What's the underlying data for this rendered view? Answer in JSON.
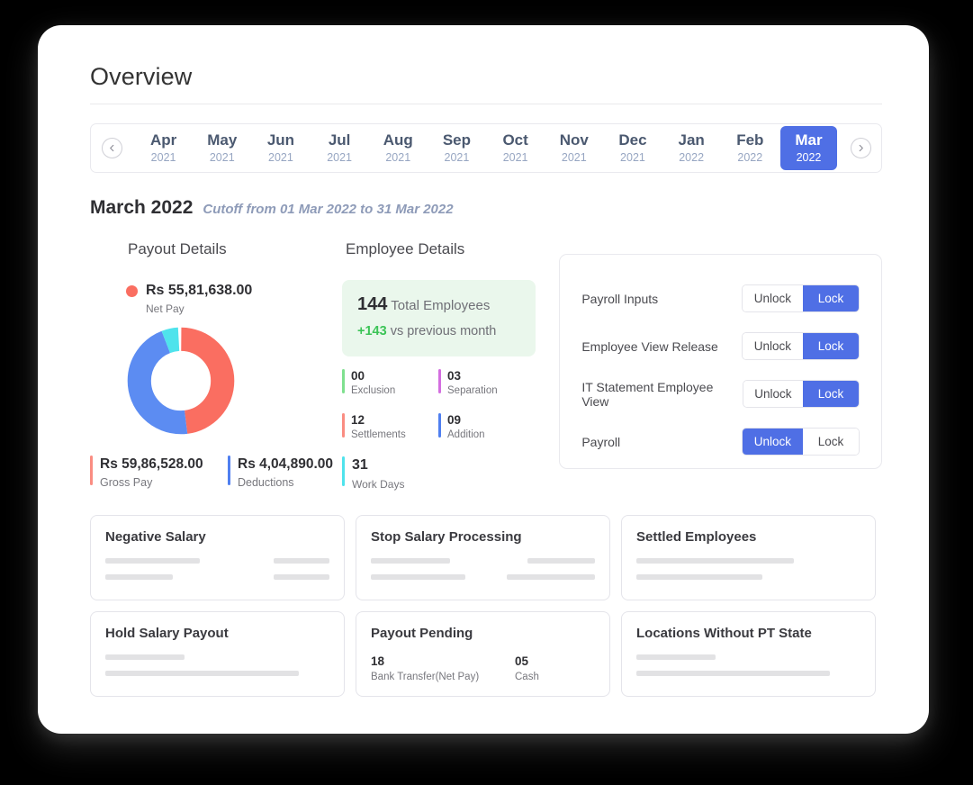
{
  "page": {
    "title": "Overview"
  },
  "month_selector": {
    "prev_icon": "chevron-left-icon",
    "next_icon": "chevron-right-icon",
    "selected_index": 11,
    "months": [
      {
        "month": "Apr",
        "year": "2021"
      },
      {
        "month": "May",
        "year": "2021"
      },
      {
        "month": "Jun",
        "year": "2021"
      },
      {
        "month": "Jul",
        "year": "2021"
      },
      {
        "month": "Aug",
        "year": "2021"
      },
      {
        "month": "Sep",
        "year": "2021"
      },
      {
        "month": "Oct",
        "year": "2021"
      },
      {
        "month": "Nov",
        "year": "2021"
      },
      {
        "month": "Dec",
        "year": "2021"
      },
      {
        "month": "Jan",
        "year": "2022"
      },
      {
        "month": "Feb",
        "year": "2022"
      },
      {
        "month": "Mar",
        "year": "2022"
      }
    ]
  },
  "cutoff": {
    "period": "March 2022",
    "text": "Cutoff from 01 Mar 2022 to 31 Mar 2022"
  },
  "payout_details": {
    "heading": "Payout Details",
    "net_pay": {
      "value": "Rs 55,81,638.00",
      "label": "Net Pay",
      "color": "#fa6e61"
    },
    "gross_pay": {
      "value": "Rs 59,86,528.00",
      "label": "Gross Pay",
      "color": "#fa8d82"
    },
    "deductions": {
      "value": "Rs 4,04,890.00",
      "label": "Deductions",
      "color": "#4f7ff0"
    }
  },
  "chart_data": {
    "type": "pie",
    "title": "Payout Details",
    "categories": [
      "Net Pay",
      "Deductions",
      "Work Days"
    ],
    "values": [
      55.82,
      4.05,
      5.0
    ],
    "percentages": [
      48,
      46,
      6
    ],
    "colors": [
      "#fa6e61",
      "#5c8cf2",
      "#4fe3ec"
    ],
    "donut": true,
    "legend": "top-left"
  },
  "employee_details": {
    "heading": "Employee Details",
    "summary": {
      "count": "144",
      "count_label": "Total Employees",
      "delta": "+143",
      "delta_label": "vs previous month",
      "delta_color": "#3cc457",
      "bg_color": "#eaf7ec"
    },
    "cells": [
      {
        "num": "00",
        "label": "Exclusion",
        "color": "#7fe08f"
      },
      {
        "num": "03",
        "label": "Separation",
        "color": "#d46ee0"
      },
      {
        "num": "12",
        "label": "Settlements",
        "color": "#fa8d82"
      },
      {
        "num": "09",
        "label": "Addition",
        "color": "#4f7ff0"
      }
    ],
    "work_days": {
      "num": "31",
      "label": "Work Days",
      "color": "#4fe3ec"
    }
  },
  "lock_panel": {
    "rows": [
      {
        "label": "Payroll Inputs",
        "unlock": "Unlock",
        "lock": "Lock",
        "active": "lock"
      },
      {
        "label": "Employee View Release",
        "unlock": "Unlock",
        "lock": "Lock",
        "active": "lock"
      },
      {
        "label": "IT Statement Employee View",
        "unlock": "Unlock",
        "lock": "Lock",
        "active": "lock"
      },
      {
        "label": "Payroll",
        "unlock": "Unlock",
        "lock": "Lock",
        "active": "unlock"
      }
    ],
    "active_color": "#4f6fe5"
  },
  "bottom_cards": [
    {
      "title": "Negative Salary",
      "type": "skeleton"
    },
    {
      "title": "Stop Salary Processing",
      "type": "skeleton"
    },
    {
      "title": "Settled Employees",
      "type": "skeleton"
    },
    {
      "title": "Hold Salary Payout",
      "type": "skeleton"
    },
    {
      "title": "Payout Pending",
      "type": "data"
    },
    {
      "title": "Locations Without PT State",
      "type": "skeleton"
    }
  ],
  "payout_pending": {
    "title": "Payout Pending",
    "items": [
      {
        "num": "18",
        "label": "Bank Transfer(Net Pay)"
      },
      {
        "num": "05",
        "label": "Cash"
      }
    ]
  }
}
